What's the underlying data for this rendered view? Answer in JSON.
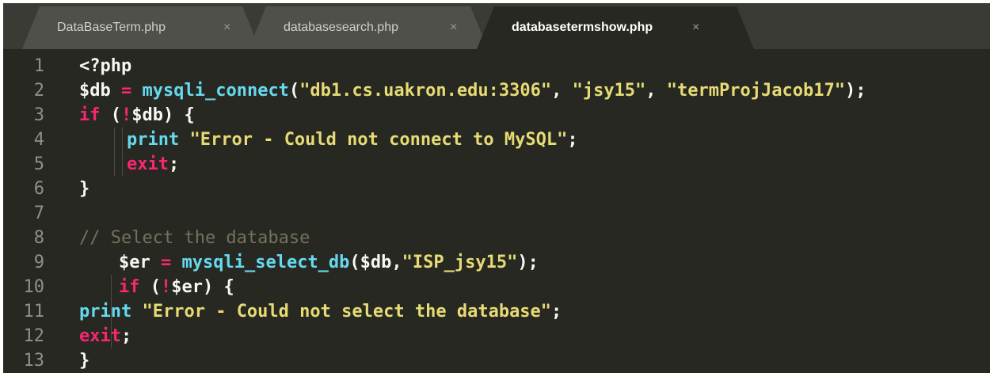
{
  "tabs": [
    {
      "label": "DataBaseTerm.php",
      "close": "×",
      "active": false
    },
    {
      "label": "databasesearch.php",
      "close": "×",
      "active": false
    },
    {
      "label": "databasetermshow.php",
      "close": "×",
      "active": true
    }
  ],
  "editor": {
    "theme_colors": {
      "background": "#272822",
      "keyword": "#f92672",
      "function": "#66d9ef",
      "string": "#e6db74",
      "comment": "#75715e",
      "text": "#f8f8f2"
    },
    "lines": [
      {
        "n": "1",
        "tokens": [
          {
            "t": "<?php",
            "c": "pun"
          }
        ]
      },
      {
        "n": "2",
        "tokens": [
          {
            "t": "$db",
            "c": "var"
          },
          {
            "t": " = ",
            "c": "op"
          },
          {
            "t": "mysqli_connect",
            "c": "fn"
          },
          {
            "t": "(",
            "c": "pun"
          },
          {
            "t": "\"db1.cs.uakron.edu:3306\"",
            "c": "str"
          },
          {
            "t": ", ",
            "c": "pun"
          },
          {
            "t": "\"jsy15\"",
            "c": "str"
          },
          {
            "t": ", ",
            "c": "pun"
          },
          {
            "t": "\"termProjJacob17\"",
            "c": "str"
          },
          {
            "t": ");",
            "c": "pun"
          }
        ]
      },
      {
        "n": "3",
        "tokens": [
          {
            "t": "if",
            "c": "kw"
          },
          {
            "t": " (",
            "c": "pun"
          },
          {
            "t": "!",
            "c": "op"
          },
          {
            "t": "$db) {",
            "c": "pun"
          }
        ]
      },
      {
        "n": "4",
        "tokens": [
          {
            "t": "print",
            "c": "fn"
          },
          {
            "t": " ",
            "c": "pun"
          },
          {
            "t": "\"Error - Could not connect to MySQL\"",
            "c": "str"
          },
          {
            "t": ";",
            "c": "pun"
          }
        ]
      },
      {
        "n": "5",
        "tokens": [
          {
            "t": "exit",
            "c": "kw"
          },
          {
            "t": ";",
            "c": "pun"
          }
        ]
      },
      {
        "n": "6",
        "tokens": [
          {
            "t": "}",
            "c": "pun"
          }
        ]
      },
      {
        "n": "7",
        "tokens": []
      },
      {
        "n": "8",
        "tokens": [
          {
            "t": "// Select the database",
            "c": "cm"
          }
        ]
      },
      {
        "n": "9",
        "tokens": [
          {
            "t": "$er",
            "c": "var"
          },
          {
            "t": " = ",
            "c": "op"
          },
          {
            "t": "mysqli_select_db",
            "c": "fn"
          },
          {
            "t": "($db,",
            "c": "pun"
          },
          {
            "t": "\"ISP_jsy15\"",
            "c": "str"
          },
          {
            "t": ");",
            "c": "pun"
          }
        ]
      },
      {
        "n": "10",
        "tokens": [
          {
            "t": "if",
            "c": "kw"
          },
          {
            "t": " (",
            "c": "pun"
          },
          {
            "t": "!",
            "c": "op"
          },
          {
            "t": "$er) {",
            "c": "pun"
          }
        ]
      },
      {
        "n": "11",
        "tokens": [
          {
            "t": "print",
            "c": "fn"
          },
          {
            "t": " ",
            "c": "pun"
          },
          {
            "t": "\"Error - Could not select the database\"",
            "c": "str"
          },
          {
            "t": ";",
            "c": "pun"
          }
        ]
      },
      {
        "n": "12",
        "tokens": [
          {
            "t": "exit",
            "c": "kw"
          },
          {
            "t": ";",
            "c": "pun"
          }
        ]
      },
      {
        "n": "13",
        "tokens": [
          {
            "t": "}",
            "c": "pun"
          }
        ]
      }
    ]
  }
}
